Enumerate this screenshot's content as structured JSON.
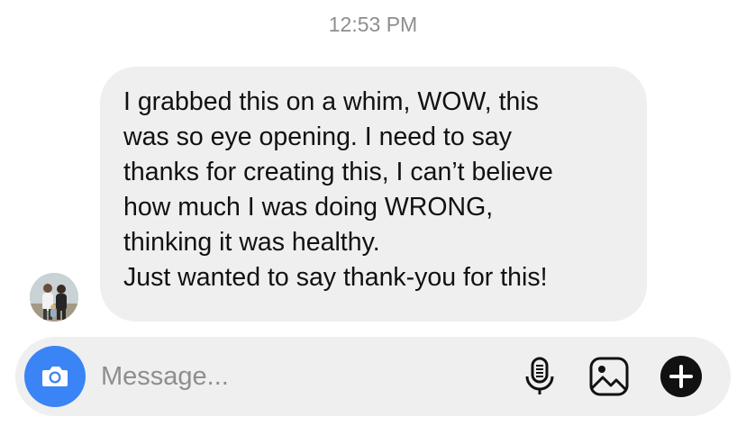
{
  "thread": {
    "timestamp": "12:53 PM"
  },
  "message": {
    "lines": [
      "I grabbed this on a whim, WOW, this",
      "was so eye opening. I need to say",
      "thanks for creating this, I can’t believe",
      "how much I was doing WRONG,",
      "thinking it was healthy.",
      "Just wanted to say thank-you for this!"
    ]
  },
  "composer": {
    "placeholder": "Message..."
  },
  "icons": {
    "camera": "camera-icon",
    "mic": "microphone-icon",
    "gallery": "image-gallery-icon",
    "plus": "plus-icon"
  },
  "colors": {
    "accent": "#3a84f5",
    "bubble": "#efefef",
    "timestamp": "#8e8e8e"
  }
}
